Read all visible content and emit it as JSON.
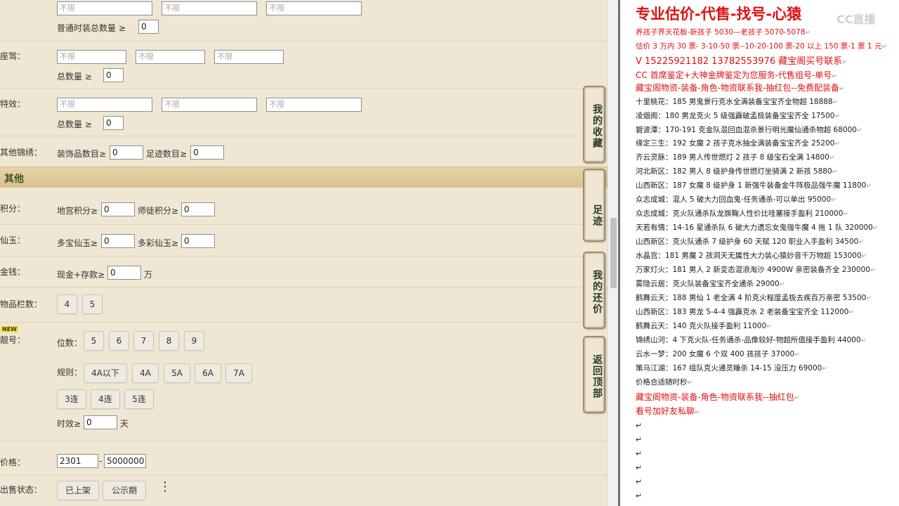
{
  "filters": {
    "row_top": {
      "inputs": [
        "不限",
        "不限",
        "不限"
      ]
    },
    "normal_fashion_total": {
      "label": "普通时装总数量 ≥",
      "value": "0"
    },
    "mount": {
      "label": "座驾：",
      "inputs": [
        "不限",
        "不限",
        "不限"
      ],
      "total_label": "总数量 ≥",
      "total_value": "0"
    },
    "effect": {
      "label": "特效：",
      "inputs": [
        "不限",
        "不限",
        "不限"
      ],
      "total_label": "总数量 ≥",
      "total_value": "0"
    },
    "other_brocade": {
      "label": "其他锦绣：",
      "decor_label": "装饰品数目≥",
      "decor_value": "0",
      "footprint_label": "足迹数目≥",
      "footprint_value": "0"
    },
    "section_other": "其他",
    "points": {
      "label": "积分：",
      "dungeon_label": "地宫积分≥",
      "dungeon_value": "0",
      "master_label": "师徒积分≥",
      "master_value": "0"
    },
    "jade": {
      "label": "仙玉：",
      "multi_label": "多宝仙玉≥",
      "multi_value": "0",
      "color_label": "多彩仙玉≥",
      "color_value": "0"
    },
    "money": {
      "label": "金钱：",
      "cash_label": "现金+存款≥",
      "cash_value": "0",
      "unit": "万"
    },
    "slots": {
      "label": "物品栏数：",
      "options": [
        "4",
        "5"
      ]
    },
    "pretty_id": {
      "badge": "NEW",
      "label": "靓号：",
      "digits_label": "位数：",
      "digits": [
        "5",
        "6",
        "7",
        "8",
        "9"
      ],
      "rule_label": "规则：",
      "rules": [
        "4A以下",
        "4A",
        "5A",
        "6A",
        "7A"
      ],
      "streaks": [
        "3连",
        "4连",
        "5连"
      ],
      "time_label": "时效≥",
      "time_value": "0",
      "time_unit": "天"
    },
    "price": {
      "label": "价格：",
      "min": "2301",
      "sep": "-",
      "max": "5000000"
    },
    "sale_status": {
      "label": "出售状态：",
      "options": [
        "已上架",
        "公示期"
      ]
    }
  },
  "side_tabs": [
    "我的收藏",
    "足迹",
    "我的还价",
    "返回顶部"
  ],
  "notes": {
    "title": "专业估价-代售-找号-心猿",
    "lines": [
      {
        "text": "养孩子界天花板-新孩子 5030—老孩子 5070-5078",
        "red": true
      },
      {
        "text": "估价 3 万内 30 票- 3-10-50 票--10-20-100 票-20 以上 150 票-1 票 1 元",
        "red": true
      },
      {
        "text": "V 15225921182    13782553976    藏宝阁买号联系",
        "red": true,
        "big": true
      },
      {
        "text": "CC 首席鉴定+大神金牌鉴定为您服务-代售组号-单号",
        "red": true,
        "big": true
      },
      {
        "text": "藏宝阁物资-装备-角色-物资联系我-抽红包--免费配装备",
        "red": true,
        "big": true
      },
      {
        "text": "十里桃花：185 男鬼景行克水全满装备宝宝齐全物超 18888",
        "red": false
      },
      {
        "text": "凌烟阁：180 男龙克火 5 级强霹破孟极装备宝宝齐全 17500",
        "red": false
      },
      {
        "text": "碧波潭：170-191 克金队混回血混杀景行明光魔仙通杀物超 68000",
        "red": false
      },
      {
        "text": "缘定三生：192 女魔 2 孩子克水抽全满装备宝宝齐全 25200",
        "red": false
      },
      {
        "text": "齐云灵脉：189 男人传世燃灯 2 孩子 8 级宝石全满 14800",
        "red": false
      },
      {
        "text": "河北新区：182 男人 8 级护身传世燃灯坐骑满 2 新孩 5880",
        "red": false
      },
      {
        "text": "山西新区：187 女魔 8 级护身 1 新强牛装备金牛阵极品强牛魔 11800",
        "red": false
      },
      {
        "text": "众志成城：混人 5 破大力回血鬼-任务通杀-可以单出 95000",
        "red": false
      },
      {
        "text": "众志成城：克火队通杀队龙旗鞠人性价比哇塞接手盈利 210000",
        "red": false
      },
      {
        "text": "天若有情：14-16 星通杀队 6 破大力遗忘女鬼强牛魔 4 拖 1 队 320000",
        "red": false
      },
      {
        "text": "山西新区：克火队通杀 7 级护身 60 天赋 120 职业入手盈利 34500",
        "red": false
      },
      {
        "text": "水晶宫：181 男魔 2 孩洞天无属性大力装心猿妙音千万物超 153000",
        "red": false
      },
      {
        "text": "万家灯火：181 男人 2 新変态混浪淘沙 4900W 亲密装备齐全 230000",
        "red": false
      },
      {
        "text": "雾隐云居：克火队装备宝宝齐全通杀 29000",
        "red": false
      },
      {
        "text": "鹤舞云天：188 男仙 1 老全满 4 阶克火程度孟极去疾百万亲密 53500",
        "red": false
      },
      {
        "text": "山西新区：183 男龙 5-4-4 强霹克水 2 老装备宝宝齐全 112000",
        "red": false
      },
      {
        "text": "鹤舞云天：140 克火队接手盈利 11000",
        "red": false
      },
      {
        "text": "锦绣山河：4 下克火队-任务通杀-品像较好-物超所值接手盈利 44000",
        "red": false
      },
      {
        "text": "云水一梦：200 女魔 6 个双 400 孩孩子 37000",
        "red": false
      },
      {
        "text": "策马江湖：167 组队克火通灵睡杀 14-15 没压力 69000",
        "red": false
      },
      {
        "text": "价格合适随时秒",
        "red": false
      },
      {
        "text": "藏宝阁物资-装备-角色-物资联系我--抽红包",
        "red": true,
        "big": true
      },
      {
        "text": "看号加好友私聊",
        "red": true,
        "big": true
      }
    ],
    "watermark": "CC直播"
  }
}
